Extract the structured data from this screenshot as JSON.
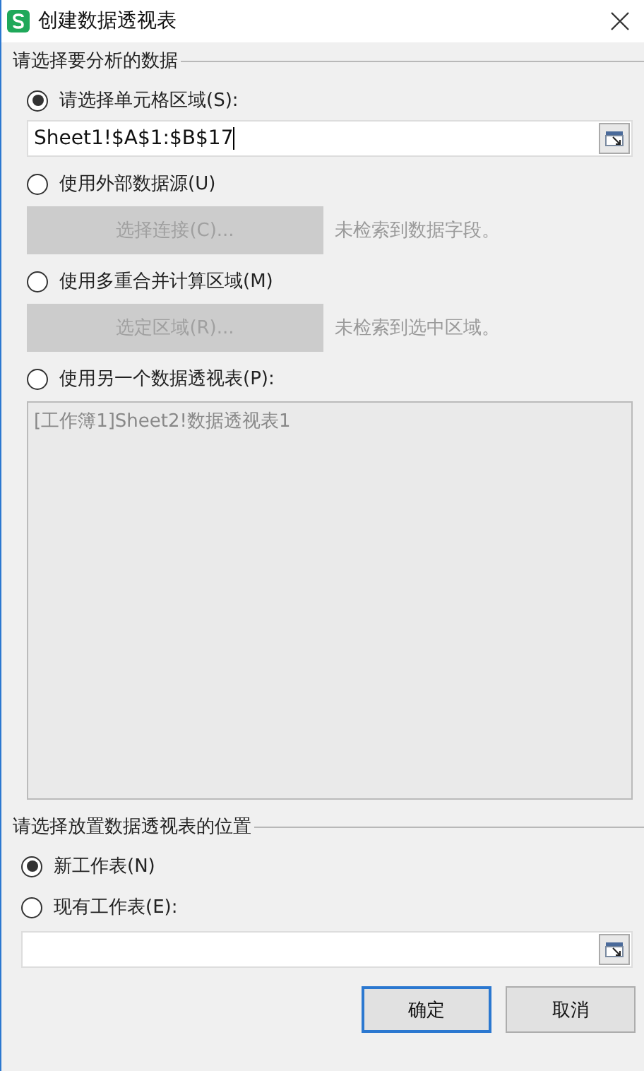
{
  "window": {
    "title": "创建数据透视表"
  },
  "source_section": {
    "legend": "请选择要分析的数据",
    "options": [
      {
        "kind": "range",
        "label": "请选择单元格区域(S):",
        "selected": true,
        "value": "Sheet1!$A$1:$B$17"
      },
      {
        "kind": "button",
        "label": "使用外部数据源(U)",
        "selected": false,
        "button": "选择连接(C)...",
        "note": "未检索到数据字段。"
      },
      {
        "kind": "button",
        "label": "使用多重合并计算区域(M)",
        "selected": false,
        "button": "选定区域(R)...",
        "note": "未检索到选中区域。"
      },
      {
        "kind": "list",
        "label": "使用另一个数据透视表(P):",
        "selected": false,
        "items": [
          "[工作簿1]Sheet2!数据透视表1"
        ]
      }
    ]
  },
  "location_section": {
    "legend": "请选择放置数据透视表的位置",
    "options": [
      {
        "kind": "plain",
        "label": "新工作表(N)",
        "selected": true
      },
      {
        "kind": "range",
        "label": "现有工作表(E):",
        "selected": false
      }
    ]
  },
  "buttons": [
    {
      "label": "确定",
      "default": true
    },
    {
      "label": "取消",
      "default": false
    }
  ]
}
